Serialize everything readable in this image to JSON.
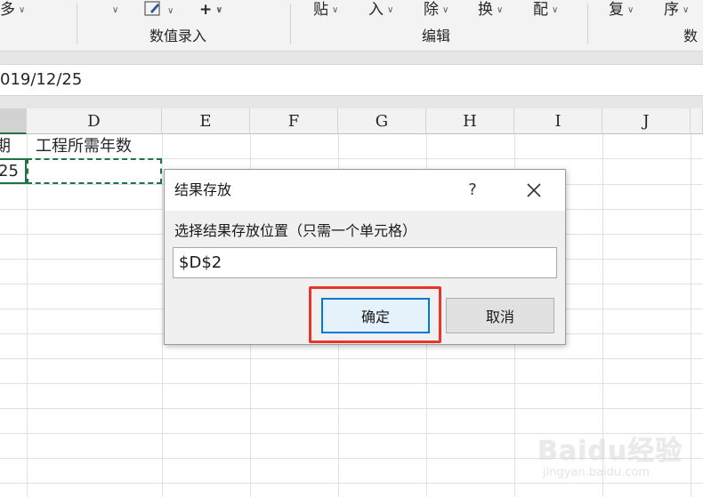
{
  "ribbon": {
    "items": [
      "多",
      "",
      "",
      "",
      "贴",
      "入",
      "除",
      "换",
      "配",
      "复",
      "序"
    ],
    "groups": [
      "数值录入",
      "编辑",
      "数"
    ]
  },
  "formula_bar": {
    "value": "019/12/25"
  },
  "columns": [
    "D",
    "E",
    "F",
    "G",
    "H",
    "I",
    "J"
  ],
  "cells": {
    "c1_partial": "期",
    "c2_partial": "25",
    "d1": "工程所需年数"
  },
  "dialog": {
    "title": "结果存放",
    "help": "?",
    "prompt": "选择结果存放位置（只需一个单元格）",
    "input_value": "$D$2",
    "ok_label": "确定",
    "cancel_label": "取消"
  },
  "colors": {
    "excel_green": "#217346",
    "highlight_red": "#e8352b",
    "focus_blue": "#0078d7"
  },
  "watermark": {
    "brand": "Baidu经验",
    "url": "jingyan.baidu.com"
  }
}
